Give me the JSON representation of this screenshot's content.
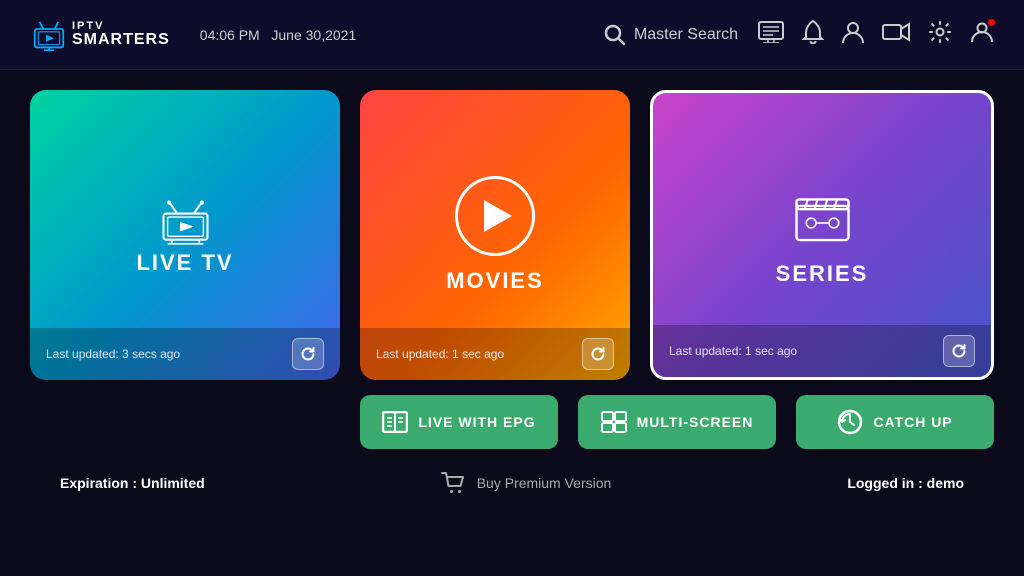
{
  "header": {
    "logo_iptv": "IPTV",
    "logo_smarters": "SMARTERS",
    "time": "04:06 PM",
    "date": "June 30,2021",
    "search_label": "Master Search"
  },
  "cards": {
    "live_tv": {
      "title": "LIVE TV",
      "update_text": "Last updated: 3 secs ago"
    },
    "movies": {
      "title": "MOVIES",
      "update_text": "Last updated: 1 sec ago"
    },
    "series": {
      "title": "SERIES",
      "update_text": "Last updated: 1 sec ago"
    }
  },
  "buttons": {
    "live_epg": "LIVE WITH EPG",
    "multi_screen": "MULTI-SCREEN",
    "catch_up": "CATCH UP"
  },
  "footer": {
    "expiration_label": "Expiration : ",
    "expiration_value": "Unlimited",
    "buy_premium": "Buy Premium Version",
    "logged_in_label": "Logged in : ",
    "logged_in_value": "demo"
  }
}
